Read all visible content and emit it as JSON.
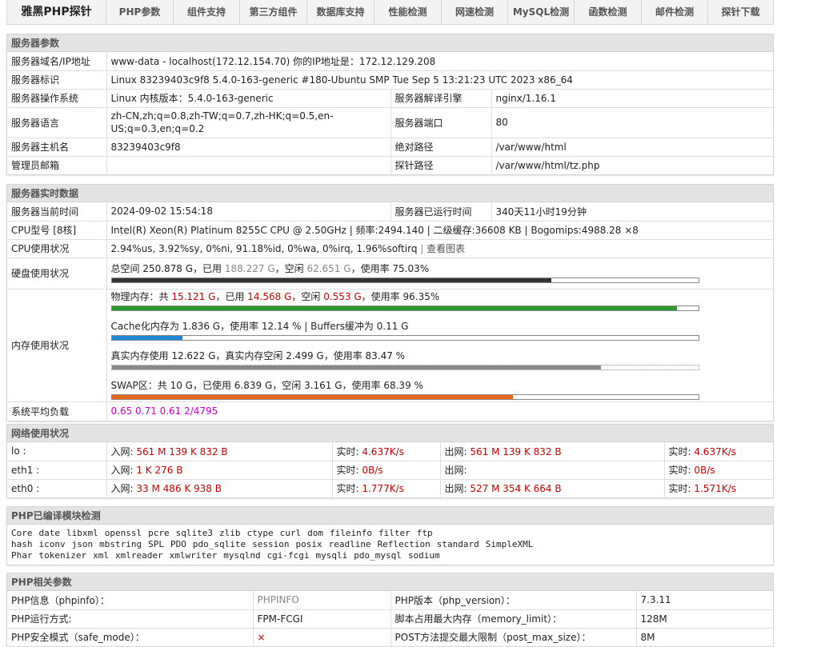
{
  "nav": {
    "items": [
      "雅黑PHP探针",
      "PHP参数",
      "组件支持",
      "第三方组件",
      "数据库支持",
      "性能检测",
      "网速检测",
      "MySQL检测",
      "函数检测",
      "邮件检测",
      "探针下载"
    ]
  },
  "server": {
    "title": "服务器参数",
    "domain_label": "服务器域名/IP地址",
    "domain_value": "www-data - localhost(172.12.154.70)  你的IP地址是：172.12.129.208",
    "id_label": "服务器标识",
    "id_value": "Linux 83239403c9f8 5.4.0-163-generic #180-Ubuntu SMP Tue Sep 5 13:21:23 UTC 2023 x86_64",
    "os_label": "服务器操作系统",
    "os_value": "Linux  内核版本：5.4.0-163-generic",
    "engine_label": "服务器解译引擎",
    "engine_value": "nginx/1.16.1",
    "lang_label": "服务器语言",
    "lang_value": "zh-CN,zh;q=0.8,zh-TW;q=0.7,zh-HK;q=0.5,en-US;q=0.3,en;q=0.2",
    "port_label": "服务器端口",
    "port_value": "80",
    "host_label": "服务器主机名",
    "host_value": "83239403c9f8",
    "abspath_label": "绝对路径",
    "abspath_value": "/var/www/html",
    "admin_label": "管理员邮箱",
    "admin_value": "",
    "probe_label": "探针路径",
    "probe_value": "/var/www/html/tz.php"
  },
  "realtime": {
    "title": "服务器实时数据",
    "time_label": "服务器当前时间",
    "time_value": "2024-09-02 15:54:18",
    "uptime_label": "服务器已运行时间",
    "uptime_value": "340天11小时19分钟",
    "cpu_label": "CPU型号 [8核]",
    "cpu_value": "Intel(R) Xeon(R) Platinum 8255C CPU @ 2.50GHz | 频率:2494.140 | 二级缓存:36608 KB | Bogomips:4988.28 ×8",
    "cpu_usage_label": "CPU使用状况",
    "cpu_usage_value": "2.94%us, 3.92%sy, 0%ni, 91.18%id, 0%wa, 0%irq, 1.96%softirq",
    "cpu_chart_sep": " | ",
    "cpu_chart_link": "查看图表",
    "disk_label": "硬盘使用状况",
    "disk_p1": "总空间 250.878 G，已用 ",
    "disk_used": "188.227 G",
    "disk_p2": "，空闲 ",
    "disk_free": "62.651 G",
    "disk_p3": "，使用率 75.03%",
    "disk_pct": 75.03,
    "mem_label": "内存使用状况",
    "mem_p1": "物理内存：共 ",
    "mem_total": "15.121 G",
    "mem_p2": "，已用 ",
    "mem_used": "14.568 G",
    "mem_p3": "，空闲 ",
    "mem_free": "0.553 G",
    "mem_p4": "，使用率 96.35%",
    "mem_pct": 96.35,
    "cache_text": "Cache化内存为 1.836 G，使用率 12.14 % | Buffers缓冲为 0.11 G",
    "cache_pct": 12.14,
    "real_text": "真实内存使用 12.622 G，真实内存空闲 2.499 G，使用率 83.47 %",
    "real_pct": 83.47,
    "swap_text": "SWAP区：共 10 G，已使用 6.839 G，空闲 3.161 G，使用率 68.39 %",
    "swap_pct": 68.39,
    "load_label": "系统平均负载",
    "load_value": "0.65 0.71 0.61 2/4795",
    "colors": {
      "disk": "#333333",
      "mem": "#2a9a2a",
      "cache": "#1e88d8",
      "real": "#888888",
      "swap": "#e8661a"
    }
  },
  "network": {
    "title": "网络使用状况",
    "in_label": "入网: ",
    "out_label": "出网: ",
    "rt_label": "实时: ",
    "rows": [
      {
        "name": "lo :",
        "in": "561 M 139 K 832 B",
        "in_rt": "4.637K/s",
        "out": "561 M 139 K 832 B",
        "out_rt": "4.637K/s"
      },
      {
        "name": "eth1 :",
        "in": "1 K 276 B",
        "in_rt": "0B/s",
        "out": "",
        "out_rt": "0B/s"
      },
      {
        "name": "eth0 :",
        "in": "33 M 486 K 938 B",
        "in_rt": "1.777K/s",
        "out": "527 M 354 K 664 B",
        "out_rt": "1.571K/s"
      }
    ]
  },
  "modules": {
    "title": "PHP已编译模块检测",
    "lines": [
      [
        "Core",
        "date",
        "libxml",
        "openssl",
        "pcre",
        "sqlite3",
        "zlib",
        "ctype",
        "curl",
        "dom",
        "fileinfo",
        "filter",
        "ftp"
      ],
      [
        "hash",
        "iconv",
        "json",
        "mbstring",
        "SPL",
        "PDO",
        "pdo_sqlite",
        "session",
        "posix",
        "readline",
        "Reflection",
        "standard",
        "SimpleXML"
      ],
      [
        "Phar",
        "tokenizer",
        "xml",
        "xmlreader",
        "xmlwriter",
        "mysqlnd",
        "cgi-fcgi",
        "mysqli",
        "pdo_mysql",
        "sodium"
      ]
    ]
  },
  "php": {
    "title": "PHP相关参数",
    "info_label": "PHP信息（phpinfo）：",
    "info_value": "PHPINFO",
    "version_label": "PHP版本（php_version）：",
    "version_value": "7.3.11",
    "mode_label": "PHP运行方式:",
    "mode_value": "FPM-FCGI",
    "memlimit_label": "脚本占用最大内存（memory_limit）：",
    "memlimit_value": "128M",
    "safe_label": "PHP安全模式（safe_mode）：",
    "safe_value": "×",
    "post_label": "POST方法提交最大限制（post_max_size）：",
    "post_value": "8M"
  }
}
